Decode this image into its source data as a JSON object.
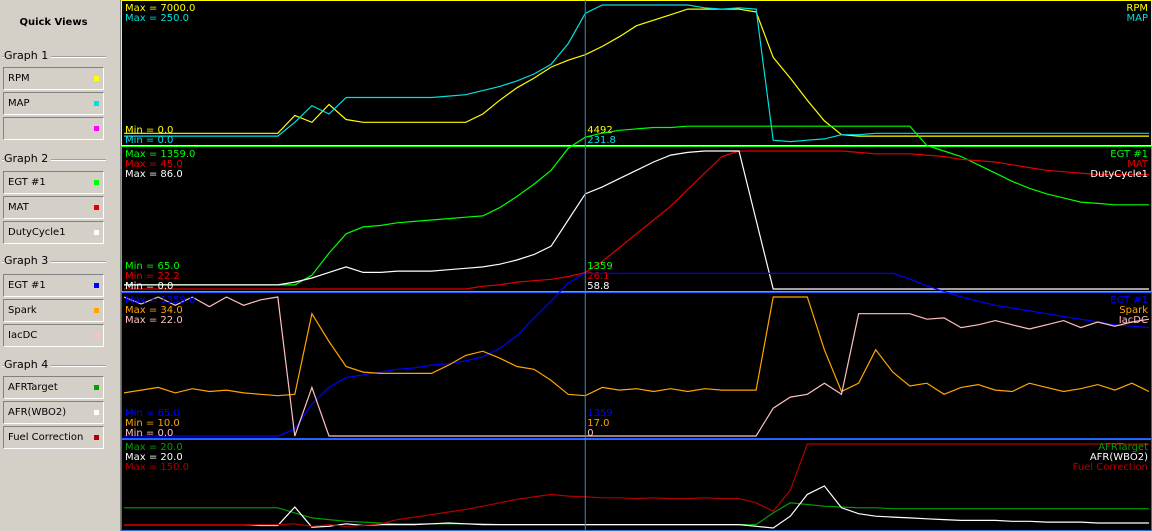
{
  "sidebar": {
    "title": "Quick Views",
    "groups": [
      {
        "label": "Graph 1",
        "slots": [
          {
            "label": "RPM",
            "color": "#ffff00"
          },
          {
            "label": "MAP",
            "color": "#00e0e0"
          },
          {
            "label": "",
            "color": "#ff00ff"
          }
        ]
      },
      {
        "label": "Graph 2",
        "slots": [
          {
            "label": "EGT #1",
            "color": "#00ff00"
          },
          {
            "label": "MAT",
            "color": "#e00000"
          },
          {
            "label": "DutyCycle1",
            "color": "#ffffff"
          }
        ]
      },
      {
        "label": "Graph 3",
        "slots": [
          {
            "label": "EGT #1",
            "color": "#0000ff"
          },
          {
            "label": "Spark",
            "color": "#ffa500"
          },
          {
            "label": "IacDC",
            "color": "#ffc0c0"
          }
        ]
      },
      {
        "label": "Graph 4",
        "slots": [
          {
            "label": "AFRTarget",
            "color": "#00a000"
          },
          {
            "label": "AFR(WBO2)",
            "color": "#ffffff"
          },
          {
            "label": "Fuel Correction",
            "color": "#b00000"
          }
        ]
      }
    ]
  },
  "cursor": {
    "sample_index": 27
  },
  "panels": [
    {
      "border_color": "#ffff00",
      "series": [
        {
          "name": "RPM",
          "color": "#ffff00",
          "max": "Max = 7000.0",
          "min": "Min = 0.0",
          "cursor_value": "4492",
          "values": [
            0.07,
            0.07,
            0.07,
            0.07,
            0.07,
            0.07,
            0.07,
            0.07,
            0.07,
            0.07,
            0.2,
            0.15,
            0.28,
            0.17,
            0.15,
            0.15,
            0.15,
            0.15,
            0.15,
            0.15,
            0.15,
            0.21,
            0.31,
            0.4,
            0.47,
            0.55,
            0.6,
            0.64,
            0.7,
            0.77,
            0.85,
            0.89,
            0.93,
            0.97,
            0.97,
            0.97,
            0.97,
            0.95,
            0.62,
            0.47,
            0.31,
            0.16,
            0.06,
            0.05,
            0.05,
            0.05,
            0.05,
            0.05,
            0.05,
            0.05,
            0.05,
            0.05,
            0.05,
            0.05,
            0.05,
            0.05,
            0.05,
            0.05,
            0.05,
            0.05,
            0.05
          ]
        },
        {
          "name": "MAP",
          "color": "#00e0e0",
          "max": "Max = 250.0",
          "min": "Min = 0.0",
          "cursor_value": "231.8",
          "values": [
            0.05,
            0.05,
            0.05,
            0.05,
            0.05,
            0.05,
            0.05,
            0.05,
            0.05,
            0.05,
            0.15,
            0.27,
            0.21,
            0.33,
            0.33,
            0.33,
            0.33,
            0.33,
            0.33,
            0.34,
            0.35,
            0.38,
            0.41,
            0.45,
            0.5,
            0.57,
            0.72,
            0.94,
            1.0,
            1.0,
            1.0,
            1.0,
            1.0,
            1.0,
            0.98,
            0.97,
            0.98,
            0.97,
            0.02,
            0.01,
            0.02,
            0.03,
            0.06,
            0.06,
            0.07,
            0.07,
            0.07,
            0.07,
            0.07,
            0.07,
            0.07,
            0.07,
            0.07,
            0.07,
            0.07,
            0.07,
            0.07,
            0.07,
            0.07,
            0.07,
            0.07
          ]
        }
      ]
    },
    {
      "border_color": "#00ff00",
      "series": [
        {
          "name": "EGT #1",
          "color": "#00ff00",
          "max": "Max = 1359.0",
          "min": "Min = 65.0",
          "cursor_value": "1359",
          "values": [
            0.03,
            0.03,
            0.03,
            0.03,
            0.03,
            0.03,
            0.03,
            0.03,
            0.03,
            0.03,
            0.03,
            0.1,
            0.26,
            0.4,
            0.45,
            0.46,
            0.48,
            0.49,
            0.5,
            0.51,
            0.52,
            0.53,
            0.59,
            0.67,
            0.76,
            0.86,
            1.02,
            1.1,
            1.13,
            1.15,
            1.16,
            1.17,
            1.17,
            1.18,
            1.18,
            1.18,
            1.18,
            1.18,
            1.18,
            1.18,
            1.18,
            1.18,
            1.18,
            1.18,
            1.18,
            1.18,
            1.18,
            1.04,
            1.0,
            0.96,
            0.9,
            0.84,
            0.78,
            0.73,
            0.69,
            0.66,
            0.63,
            0.62,
            0.61,
            0.61,
            0.61
          ]
        },
        {
          "name": "MAT",
          "color": "#e00000",
          "max": "Max = 45.0",
          "min": "Min = 22.2",
          "cursor_value": "26.1",
          "values": [
            0.0,
            0.0,
            0.0,
            0.0,
            0.0,
            0.0,
            0.0,
            0.0,
            0.0,
            0.0,
            0.0,
            0.0,
            0.0,
            0.0,
            0.0,
            0.0,
            0.0,
            0.0,
            0.0,
            0.0,
            0.0,
            0.02,
            0.03,
            0.05,
            0.06,
            0.07,
            0.09,
            0.12,
            0.2,
            0.3,
            0.4,
            0.5,
            0.6,
            0.72,
            0.84,
            0.96,
            1.0,
            1.0,
            1.0,
            1.0,
            1.0,
            1.0,
            1.0,
            0.99,
            0.98,
            0.98,
            0.98,
            0.97,
            0.96,
            0.94,
            0.93,
            0.92,
            0.9,
            0.88,
            0.86,
            0.85,
            0.84,
            0.83,
            0.83,
            0.83,
            0.83
          ]
        },
        {
          "name": "DutyCycle1",
          "color": "#ffffff",
          "max": "Max = 86.0",
          "min": "Min = 0.0",
          "cursor_value": "58.8",
          "values": [
            0.03,
            0.03,
            0.03,
            0.03,
            0.03,
            0.03,
            0.03,
            0.03,
            0.03,
            0.03,
            0.05,
            0.08,
            0.12,
            0.16,
            0.12,
            0.12,
            0.13,
            0.13,
            0.13,
            0.14,
            0.15,
            0.16,
            0.18,
            0.21,
            0.25,
            0.31,
            0.5,
            0.69,
            0.74,
            0.8,
            0.86,
            0.92,
            0.97,
            0.99,
            1.0,
            1.0,
            1.0,
            0.5,
            0.0,
            0.0,
            0.0,
            0.0,
            0.0,
            0.0,
            0.0,
            0.0,
            0.0,
            0.0,
            0.0,
            0.0,
            0.0,
            0.0,
            0.0,
            0.0,
            0.0,
            0.0,
            0.0,
            0.0,
            0.0,
            0.0,
            0.0
          ]
        }
      ]
    },
    {
      "border_color": "#2060ff",
      "series": [
        {
          "name": "EGT #1",
          "color": "#0000ff",
          "max": "Max = 1359.0",
          "min": "Min = 65.0",
          "cursor_value": "1359",
          "values": [
            0.0,
            0.0,
            0.0,
            0.0,
            0.0,
            0.0,
            0.0,
            0.0,
            0.0,
            0.0,
            0.05,
            0.23,
            0.35,
            0.42,
            0.44,
            0.46,
            0.48,
            0.49,
            0.51,
            0.52,
            0.54,
            0.57,
            0.63,
            0.72,
            0.85,
            0.97,
            1.1,
            1.17,
            1.17,
            1.17,
            1.17,
            1.17,
            1.17,
            1.17,
            1.17,
            1.17,
            1.17,
            1.17,
            1.17,
            1.17,
            1.17,
            1.17,
            1.17,
            1.17,
            1.17,
            1.17,
            1.13,
            1.08,
            1.04,
            1.0,
            0.97,
            0.94,
            0.92,
            0.9,
            0.88,
            0.86,
            0.84,
            0.82,
            0.8,
            0.79,
            0.78
          ]
        },
        {
          "name": "Spark",
          "color": "#ffa500",
          "max": "Max = 34.0",
          "min": "Min = 10.0",
          "cursor_value": "17.0",
          "values": [
            0.31,
            0.33,
            0.35,
            0.31,
            0.34,
            0.32,
            0.33,
            0.31,
            0.3,
            0.29,
            0.3,
            0.88,
            0.68,
            0.5,
            0.46,
            0.45,
            0.45,
            0.45,
            0.45,
            0.51,
            0.58,
            0.61,
            0.56,
            0.5,
            0.48,
            0.4,
            0.3,
            0.29,
            0.35,
            0.33,
            0.34,
            0.32,
            0.34,
            0.32,
            0.34,
            0.33,
            0.33,
            0.33,
            1.0,
            1.0,
            1.0,
            0.62,
            0.32,
            0.38,
            0.62,
            0.46,
            0.36,
            0.38,
            0.3,
            0.35,
            0.37,
            0.33,
            0.32,
            0.38,
            0.35,
            0.32,
            0.34,
            0.37,
            0.33,
            0.38,
            0.32
          ]
        },
        {
          "name": "IacDC",
          "color": "#ffc0c0",
          "max": "Max = 22.0",
          "min": "Min = 0.0",
          "cursor_value": "0",
          "values": [
            1.0,
            0.95,
            1.0,
            0.94,
            1.0,
            0.93,
            1.0,
            0.94,
            0.98,
            1.0,
            0.0,
            0.35,
            0.0,
            0.0,
            0.0,
            0.0,
            0.0,
            0.0,
            0.0,
            0.0,
            0.0,
            0.0,
            0.0,
            0.0,
            0.0,
            0.0,
            0.0,
            0.0,
            0.0,
            0.0,
            0.0,
            0.0,
            0.0,
            0.0,
            0.0,
            0.0,
            0.0,
            0.0,
            0.2,
            0.28,
            0.3,
            0.38,
            0.3,
            0.88,
            0.88,
            0.88,
            0.88,
            0.84,
            0.85,
            0.78,
            0.8,
            0.83,
            0.8,
            0.77,
            0.8,
            0.83,
            0.78,
            0.82,
            0.79,
            0.82,
            0.84
          ]
        }
      ]
    },
    {
      "border_color": "#2a6fd6",
      "series": [
        {
          "name": "AFRTarget",
          "color": "#00a000",
          "max": "Max = 20.0",
          "min": "",
          "cursor_value": "",
          "values": [
            0.24,
            0.24,
            0.24,
            0.24,
            0.24,
            0.24,
            0.24,
            0.24,
            0.24,
            0.24,
            0.18,
            0.12,
            0.1,
            0.08,
            0.07,
            0.06,
            0.05,
            0.05,
            0.05,
            0.05,
            0.05,
            0.05,
            0.04,
            0.04,
            0.04,
            0.04,
            0.04,
            0.04,
            0.04,
            0.04,
            0.04,
            0.04,
            0.04,
            0.04,
            0.04,
            0.04,
            0.04,
            0.04,
            0.18,
            0.3,
            0.28,
            0.26,
            0.25,
            0.24,
            0.24,
            0.23,
            0.23,
            0.23,
            0.23,
            0.23,
            0.23,
            0.23,
            0.23,
            0.23,
            0.23,
            0.23,
            0.23,
            0.23,
            0.23,
            0.23,
            0.23
          ]
        },
        {
          "name": "AFR(WBO2)",
          "color": "#ffffff",
          "max": "Max = 20.0",
          "min": "",
          "cursor_value": "",
          "values": [
            0.04,
            0.04,
            0.04,
            0.04,
            0.04,
            0.04,
            0.04,
            0.04,
            0.03,
            0.03,
            0.25,
            0.01,
            0.02,
            0.05,
            0.03,
            0.04,
            0.04,
            0.04,
            0.05,
            0.06,
            0.05,
            0.04,
            0.04,
            0.04,
            0.04,
            0.04,
            0.04,
            0.04,
            0.04,
            0.04,
            0.04,
            0.04,
            0.04,
            0.04,
            0.04,
            0.04,
            0.04,
            0.02,
            0.0,
            0.14,
            0.4,
            0.5,
            0.24,
            0.17,
            0.14,
            0.13,
            0.12,
            0.11,
            0.1,
            0.09,
            0.09,
            0.09,
            0.08,
            0.08,
            0.07,
            0.07,
            0.07,
            0.06,
            0.06,
            0.06,
            0.06
          ]
        },
        {
          "name": "Fuel Correction",
          "color": "#b00000",
          "max": "Max = 150.0",
          "min": "",
          "cursor_value": "",
          "values": [
            0.04,
            0.04,
            0.04,
            0.04,
            0.04,
            0.04,
            0.04,
            0.04,
            0.04,
            0.04,
            0.05,
            0.02,
            0.04,
            0.02,
            0.03,
            0.05,
            0.1,
            0.13,
            0.16,
            0.19,
            0.22,
            0.26,
            0.3,
            0.34,
            0.37,
            0.4,
            0.38,
            0.37,
            0.36,
            0.36,
            0.35,
            0.36,
            0.35,
            0.35,
            0.36,
            0.35,
            0.35,
            0.3,
            0.2,
            0.45,
            1.0,
            1.0,
            1.0,
            1.0,
            1.0,
            1.0,
            1.0,
            1.0,
            1.0,
            1.0,
            1.0,
            1.0,
            1.0,
            1.0,
            1.0,
            1.0,
            1.0,
            1.0,
            1.0,
            1.0,
            1.0
          ]
        }
      ]
    }
  ]
}
